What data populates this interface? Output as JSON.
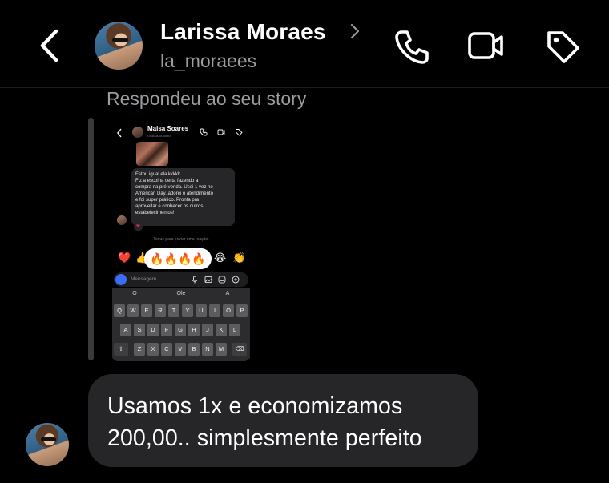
{
  "header": {
    "contact_name": "Larissa Moraes",
    "username": "la_moraees",
    "icons": [
      "back-chevron-icon",
      "phone-icon",
      "video-icon",
      "tag-icon"
    ]
  },
  "story_reply": {
    "label": "Respondeu ao seu story",
    "screenshot": {
      "contact_name": "Maisa Soares",
      "username": "maisa.soares",
      "message_lines": [
        "Estou igual ela kkkkk",
        "Fiz a escolha certa fazendo a",
        "compra na pré-venda. Usei 1 vez no",
        "American Day, adorei o atendimento",
        "e foi super prático. Pronta pra",
        "aproveitar e conhecer os outros",
        "estabelecimentos!"
      ],
      "heart_reaction": "❤",
      "hint": "Toque para enviar uma reação.",
      "reactions": [
        "❤️",
        "👍",
        "😂",
        "👏"
      ],
      "selected_reaction": "🔥🔥🔥🔥",
      "input_placeholder": "Mensagem...",
      "keyboard": {
        "suggestions": [
          "O",
          "Ole",
          "A"
        ],
        "row1": [
          "Q",
          "W",
          "E",
          "R",
          "T",
          "Y",
          "U",
          "I",
          "O",
          "P"
        ],
        "row2": [
          "A",
          "S",
          "D",
          "F",
          "G",
          "H",
          "J",
          "K",
          "L"
        ],
        "row3": [
          "Z",
          "X",
          "C",
          "V",
          "B",
          "N",
          "M"
        ]
      }
    }
  },
  "message": {
    "lines": [
      "Usamos 1x e economizamos",
      "200,00.. simplesmente perfeito"
    ]
  },
  "colors": {
    "background": "#000000",
    "bubble": "#262628",
    "secondary_text": "#9b9ba0"
  }
}
